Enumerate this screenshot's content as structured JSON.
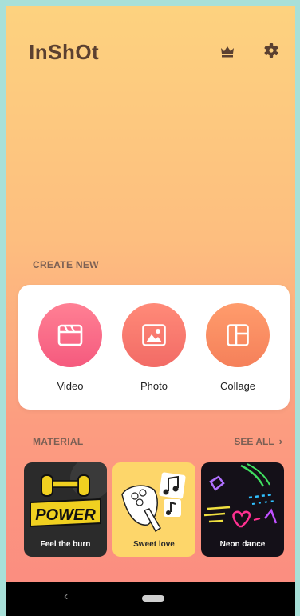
{
  "app": {
    "logo": "InShOt"
  },
  "header": {
    "premium_icon": "crown-icon",
    "settings_icon": "gear-icon"
  },
  "create_new": {
    "label": "CREATE NEW",
    "items": [
      {
        "label": "Video",
        "icon": "clapperboard-icon",
        "color": "#f55a7e"
      },
      {
        "label": "Photo",
        "icon": "image-icon",
        "color": "#f26b66"
      },
      {
        "label": "Collage",
        "icon": "collage-icon",
        "color": "#f5805a"
      }
    ]
  },
  "material": {
    "label": "MATERIAL",
    "see_all": "SEE ALL",
    "items": [
      {
        "label": "Feel the burn",
        "sticker_text": "POWER"
      },
      {
        "label": "Sweet love"
      },
      {
        "label": "Neon dance"
      }
    ]
  },
  "navbar": {
    "back_icon": "back-chevron-icon",
    "home_icon": "home-pill-icon"
  }
}
